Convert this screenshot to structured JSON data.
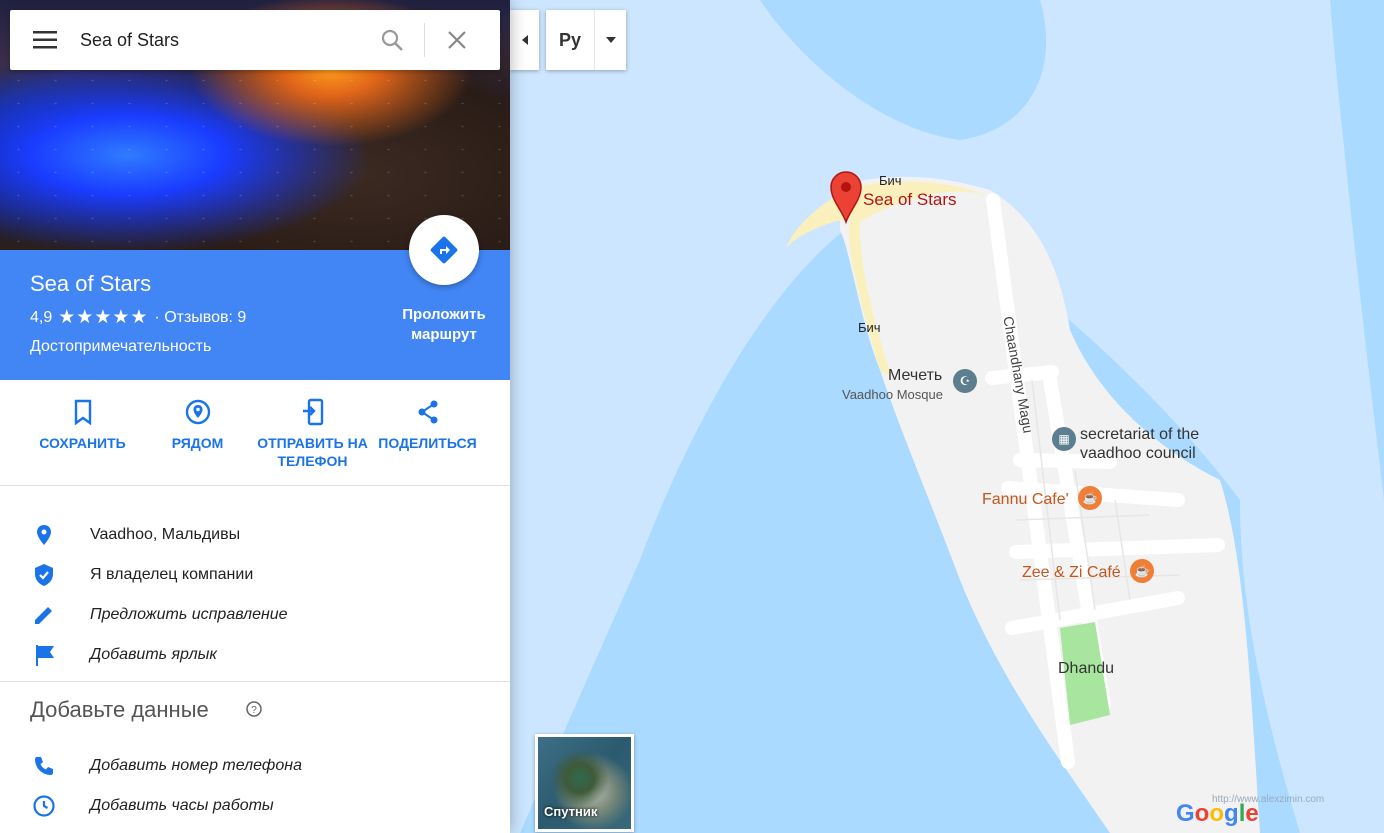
{
  "search": {
    "value": "Sea of Stars"
  },
  "place": {
    "title": "Sea of Stars",
    "rating": "4,9",
    "stars": "★★★★★",
    "reviews": "· Отзывов: 9",
    "category": "Достопримечательность",
    "route_label": "Проложить маршрут"
  },
  "actions": [
    {
      "label": "СОХРАНИТЬ",
      "icon": "bookmark-icon"
    },
    {
      "label": "РЯДОМ",
      "icon": "nearby-icon"
    },
    {
      "label": "ОТПРАВИТЬ НА ТЕЛЕФОН",
      "icon": "send-to-phone-icon"
    },
    {
      "label": "ПОДЕЛИТЬСЯ",
      "icon": "share-icon"
    }
  ],
  "info": [
    {
      "text": "Vaadhoo, Мальдивы",
      "icon": "location-pin-icon"
    },
    {
      "text": "Я владелец компании",
      "icon": "verified-shield-icon"
    },
    {
      "text": "Предложить исправление",
      "icon": "pencil-icon"
    },
    {
      "text": "Добавить ярлык",
      "icon": "flag-icon"
    }
  ],
  "add_data": {
    "title": "Добавьте данные",
    "items": [
      {
        "text": "Добавить номер телефона",
        "icon": "phone-icon"
      },
      {
        "text": "Добавить часы работы",
        "icon": "clock-icon"
      }
    ]
  },
  "map": {
    "language": "Ру",
    "satellite_label": "Спутник",
    "watermark": "http://www.alexzimin.com",
    "labels": {
      "beach1": "Бич",
      "beach2": "Бич",
      "place_marker": "Sea of Stars",
      "mosque": "Мечеть",
      "mosque_en": "Vaadhoo Mosque",
      "road": "Chaandhany Magu",
      "council": "secretariat of the vaadhoo council",
      "cafe1": "Fannu Cafe'",
      "cafe2": "Zee & Zi Café",
      "dhandu": "Dhandu"
    },
    "colors": {
      "water": "#aadaff",
      "land": "#f2f2f2",
      "beach": "#faf0be",
      "park": "#a8e6a0",
      "marker": "#ea4335",
      "panel_header": "#4285f4",
      "action_blue": "#1a73e8"
    }
  }
}
